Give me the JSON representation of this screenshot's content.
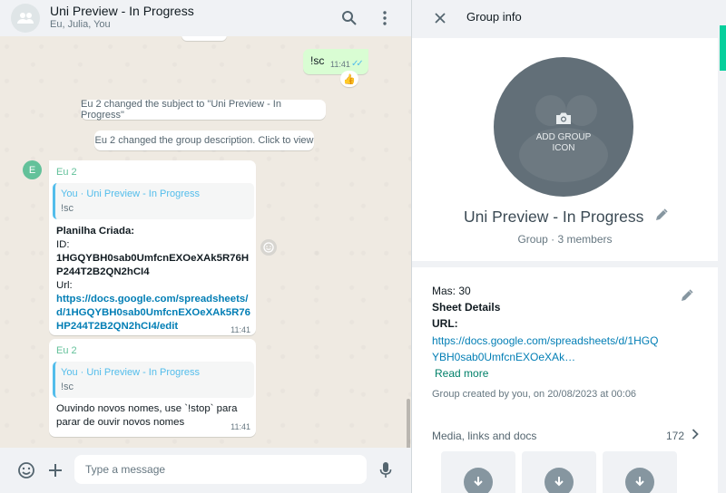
{
  "chat": {
    "header": {
      "title": "Uni Preview - In Progress",
      "subtitle": "Eu, Julia, You"
    },
    "outgoing": {
      "text": "!sc",
      "time": "11:41",
      "reaction": "👍"
    },
    "system_messages": [
      "Eu 2 changed the subject to \"Uni Preview - In Progress\"",
      "Eu 2 changed the group description. Click to view"
    ],
    "sender_avatar_letter": "E",
    "messages": [
      {
        "sender": "Eu 2",
        "quote_title": "You · Uni Preview - In Progress",
        "quote_body": "!sc",
        "lines": [
          "Planilha Criada:",
          "ID:",
          "1HGQYBH0sab0UmfcnEXOeXAk5R76H",
          "P244T2B2QN2hCI4",
          "Url:",
          "https://docs.google.com/spreadsheets/",
          "d/1HGQYBH0sab0UmfcnEXOeXAk5R76",
          "HP244T2B2QN2hCI4/edit"
        ],
        "time": "11:41"
      },
      {
        "sender": "Eu 2",
        "quote_title": "You · Uni Preview - In Progress",
        "quote_body": "!sc",
        "lines": [
          "Ouvindo novos nomes, use `!stop` para",
          "parar de ouvir novos nomes"
        ],
        "time": "11:41"
      }
    ],
    "composer": {
      "placeholder": "Type a message"
    }
  },
  "info": {
    "title": "Group info",
    "photo_label_line1": "ADD GROUP",
    "photo_label_line2": "ICON",
    "group_name": "Uni Preview - In Progress",
    "group_meta": "Group · 3 members",
    "description": {
      "line1": "Mas: 30",
      "line2": "Sheet Details",
      "line3": "URL:",
      "link_line1": "https://docs.google.com/spreadsheets/d/1HGQ",
      "link_line2": "YBH0sab0UmfcnEXOeXAk…"
    },
    "read_more": "Read more",
    "created": "Group created by you, on 20/08/2023 at 00:06",
    "media": {
      "label": "Media, links and docs",
      "count": "172"
    }
  },
  "colors": {
    "accent": "#008069",
    "link": "#027eb5",
    "sender": "#63c19a",
    "outgoing_bubble": "#d9fdd3"
  }
}
